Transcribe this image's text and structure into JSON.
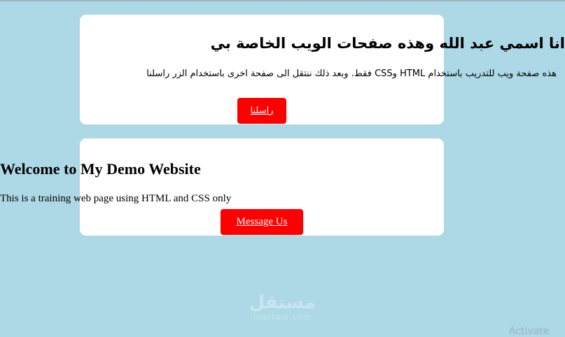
{
  "arabic_card": {
    "title": "انا اسمي عبد الله وهذه صفحات الويب الخاصة بي",
    "text": "هذه صفحة ويب للتدريب باستخدام HTML وCSS فقط. وبعد ذلك ننتقل الى صفحة اخرى باستخدام الزر راسلنا",
    "button_label": "راسلنا"
  },
  "english_card": {
    "title": "Welcome to My Demo Website",
    "text": "This is a training web page using HTML and CSS only",
    "button_label": "Message Us"
  },
  "watermark": {
    "arabic": "مستقل",
    "latin": "mostaql.com"
  },
  "os_overlay": {
    "activate_text": "Activate"
  },
  "colors": {
    "background": "#add8e6",
    "card": "#ffffff",
    "button": "#ff0000",
    "button_text": "#ffffff"
  }
}
